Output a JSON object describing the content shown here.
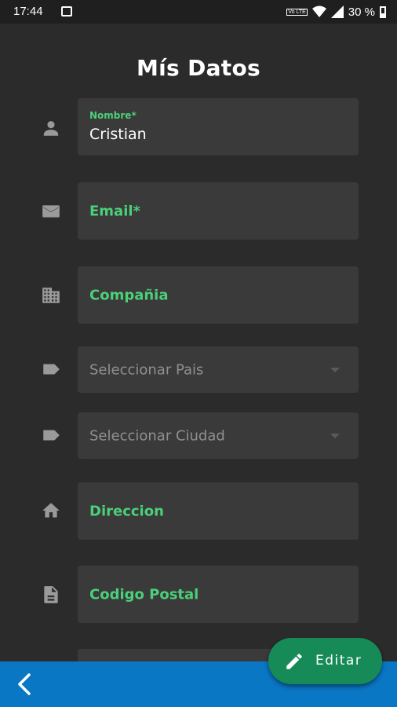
{
  "status_bar": {
    "time": "17:44",
    "volte": "Vo LTE",
    "battery": "30 %"
  },
  "page": {
    "title": "Mís Datos"
  },
  "form": {
    "nombre": {
      "label": "Nombre*",
      "value": "Cristian",
      "icon": "person-icon"
    },
    "email": {
      "label": "Email*",
      "icon": "mail-icon"
    },
    "compania": {
      "label": "Compañia",
      "icon": "building-icon"
    },
    "pais": {
      "placeholder": "Seleccionar Pais",
      "icon": "label-icon"
    },
    "ciudad": {
      "placeholder": "Seleccionar Ciudad",
      "icon": "label-icon"
    },
    "direccion": {
      "label": "Direccion",
      "icon": "home-icon"
    },
    "codigo_postal": {
      "label": "Codigo Postal",
      "icon": "document-icon"
    }
  },
  "actions": {
    "edit_label": "Editar"
  },
  "colors": {
    "accent_green": "#4bd07a",
    "fab_green": "#178b57",
    "bottom_bar_blue": "#0a77c4",
    "background": "#2b2b2b",
    "field_bg": "#3a3a3a"
  }
}
